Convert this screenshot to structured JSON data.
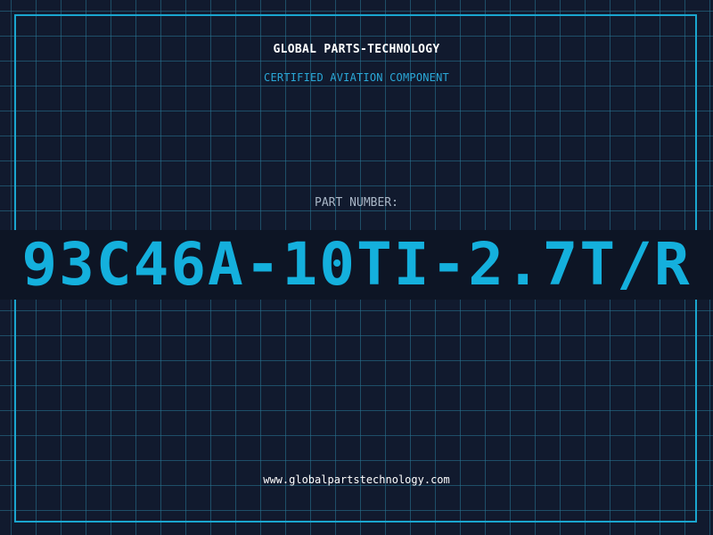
{
  "header": {
    "company": "GLOBAL PARTS-TECHNOLOGY",
    "certification": "CERTIFIED AVIATION COMPONENT"
  },
  "part": {
    "label": "PART NUMBER:",
    "number": "93C46A-10TI-2.7T/R"
  },
  "footer": {
    "website": "www.globalpartstechnology.com"
  },
  "colors": {
    "background": "#111a2e",
    "grid": "#287896",
    "accent": "#14b0dd",
    "label": "#a9b6c6"
  }
}
